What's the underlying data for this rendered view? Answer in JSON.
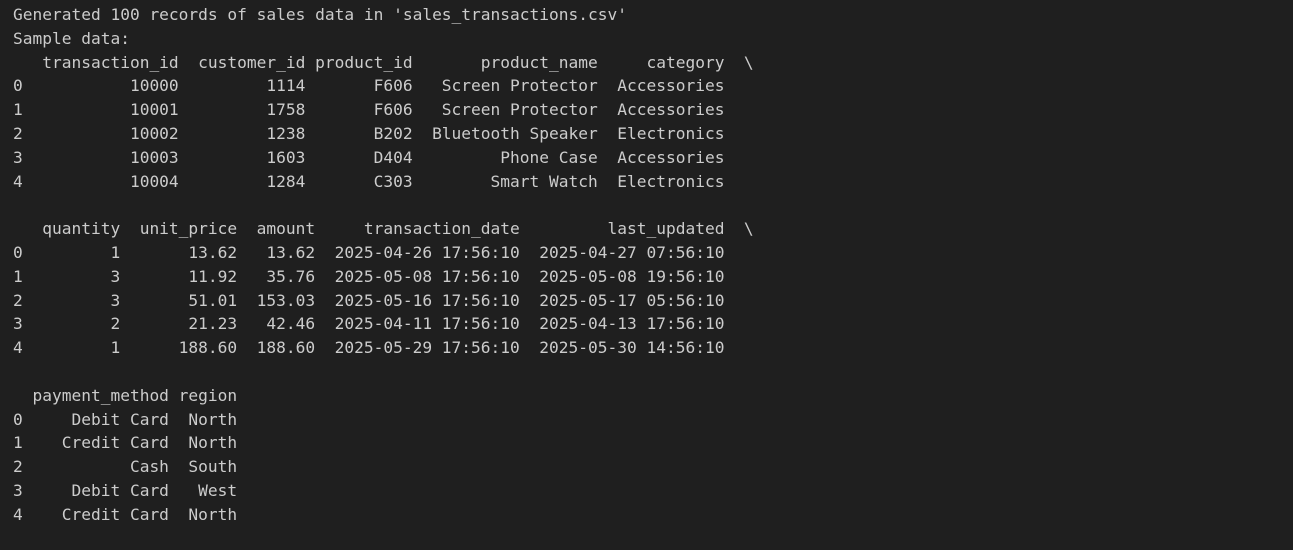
{
  "output": {
    "lines": [
      "Generated 100 records of sales data in 'sales_transactions.csv'",
      "Sample data:",
      "   transaction_id  customer_id product_id       product_name     category  \\",
      "0           10000         1114       F606   Screen Protector  Accessories   ",
      "1           10001         1758       F606   Screen Protector  Accessories   ",
      "2           10002         1238       B202  Bluetooth Speaker  Electronics   ",
      "3           10003         1603       D404         Phone Case  Accessories   ",
      "4           10004         1284       C303        Smart Watch  Electronics   ",
      "",
      "   quantity  unit_price  amount     transaction_date         last_updated  \\",
      "0         1       13.62   13.62  2025-04-26 17:56:10  2025-04-27 07:56:10   ",
      "1         3       11.92   35.76  2025-05-08 17:56:10  2025-05-08 19:56:10   ",
      "2         3       51.01  153.03  2025-05-16 17:56:10  2025-05-17 05:56:10   ",
      "3         2       21.23   42.46  2025-04-11 17:56:10  2025-04-13 17:56:10   ",
      "4         1      188.60  188.60  2025-05-29 17:56:10  2025-05-30 14:56:10   ",
      "",
      "  payment_method region",
      "0     Debit Card  North",
      "1    Credit Card  North",
      "2           Cash  South",
      "3     Debit Card   West",
      "4    Credit Card  North"
    ]
  }
}
